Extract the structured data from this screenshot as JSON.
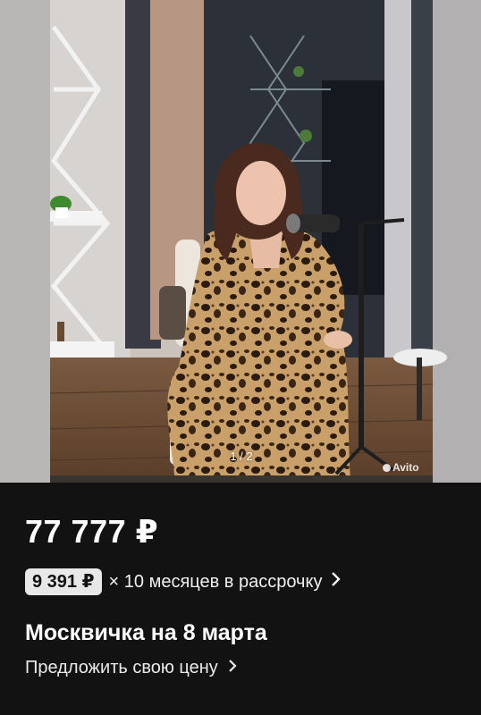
{
  "gallery": {
    "counter": "1 / 2",
    "watermark": "Avito"
  },
  "listing": {
    "price": "77 777 ₽",
    "installment_amount": "9 391 ₽",
    "installment_text": "× 10 месяцев в рассрочку",
    "title": "Москвичка на 8 марта",
    "offer_label": "Предложить свою цену"
  },
  "icons": {
    "installment_chevron": "chevron-right-icon",
    "offer_chevron": "chevron-right-icon"
  },
  "colors": {
    "background": "#121212",
    "text": "#ffffff",
    "badge_bg": "#e8e8e8"
  }
}
